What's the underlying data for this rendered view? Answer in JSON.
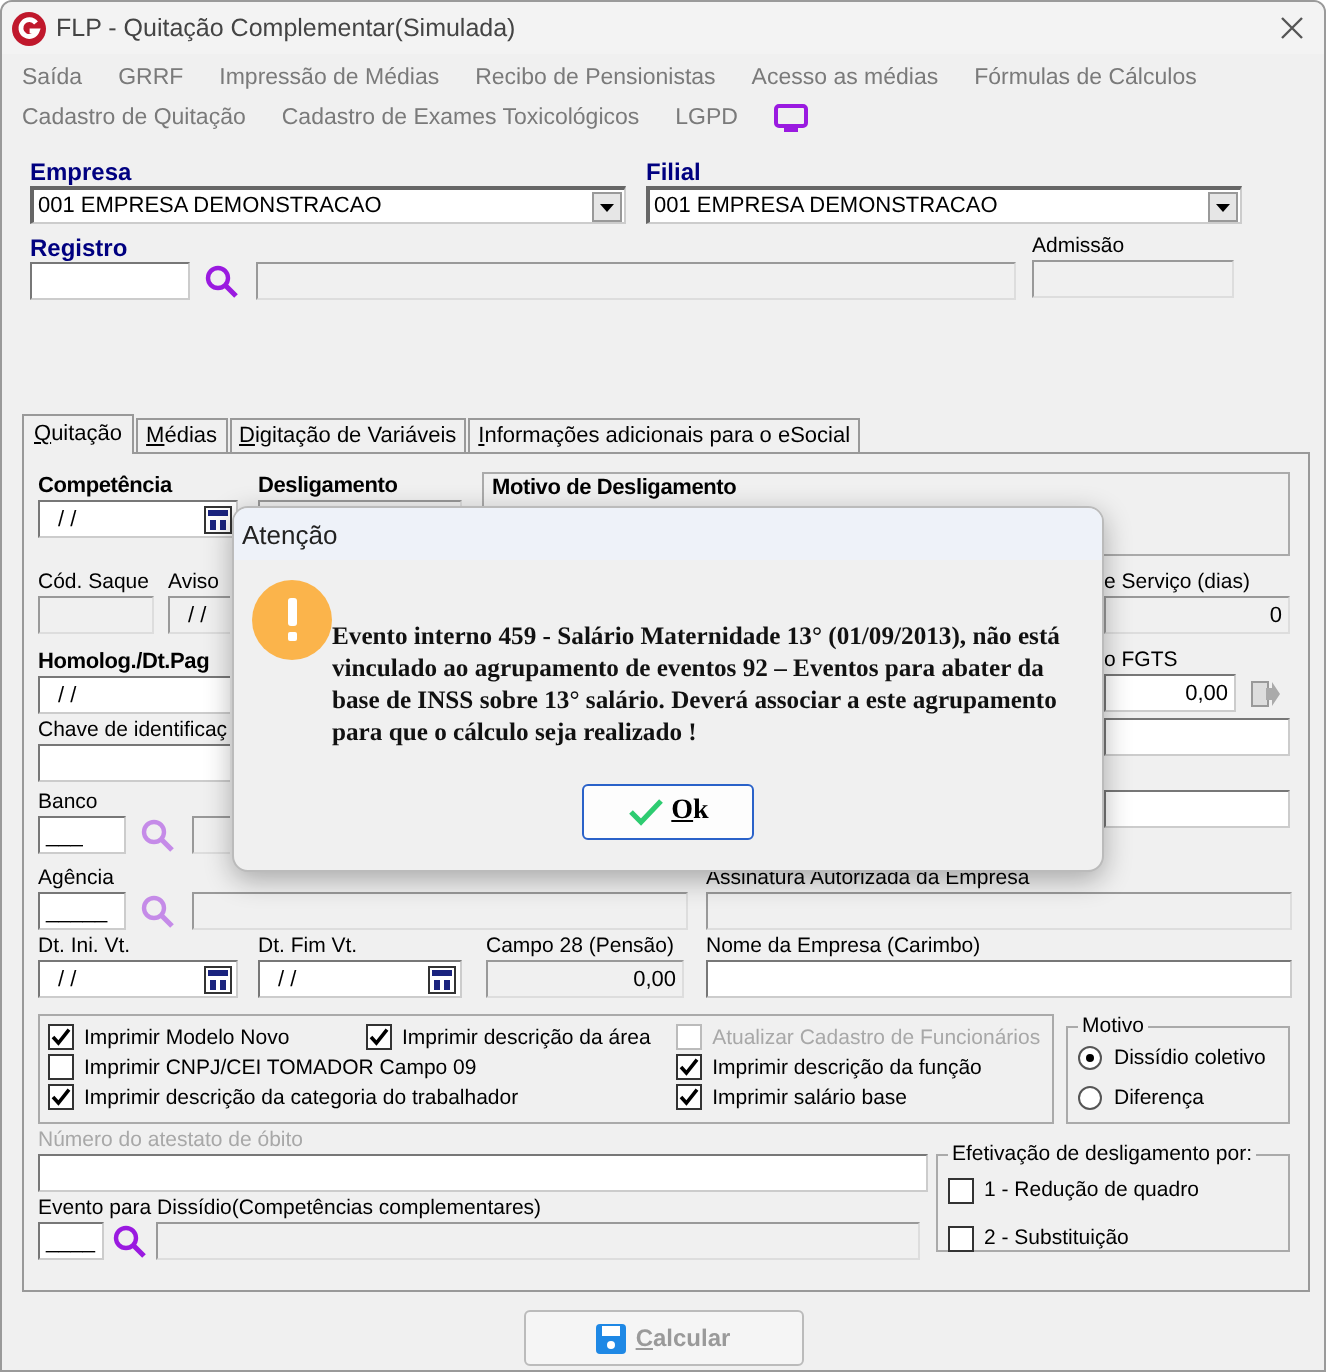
{
  "window": {
    "title": "FLP - Quitação Complementar(Simulada)"
  },
  "menu": [
    [
      {
        "label": "Saída"
      },
      {
        "label": "GRRF"
      },
      {
        "label": "Impressão de Médias"
      },
      {
        "label": "Recibo de Pensionistas"
      },
      {
        "label": "Acesso as médias"
      },
      {
        "label": "Fórmulas de Cálculos"
      }
    ],
    [
      {
        "label": "Cadastro de Quitação"
      },
      {
        "label": "Cadastro de Exames Toxicológicos"
      },
      {
        "label": "LGPD"
      }
    ]
  ],
  "header": {
    "empresa": {
      "label": "Empresa",
      "value": "001 EMPRESA DEMONSTRACAO"
    },
    "filial": {
      "label": "Filial",
      "value": "001 EMPRESA DEMONSTRACAO"
    },
    "registro": {
      "label": "Registro"
    },
    "admissao": {
      "label": "Admissão"
    }
  },
  "tabs": [
    {
      "label": "Quitação",
      "selected": true
    },
    {
      "label": "Médias",
      "selected": false
    },
    {
      "label": "Digitação de Variáveis",
      "selected": false
    },
    {
      "label": "Informações adicionais para o eSocial",
      "selected": false
    }
  ],
  "quitacao": {
    "competencia": {
      "label": "Competência",
      "value": "/ /"
    },
    "desligamento": {
      "label": "Desligamento"
    },
    "motivo_desligamento": {
      "label": "Motivo de Desligamento"
    },
    "cod_saque": {
      "label": "Cód. Saque"
    },
    "aviso": {
      "label": "Aviso",
      "value": "/ /"
    },
    "tempo_servico": {
      "label": "e Serviço (dias)",
      "value": "0"
    },
    "homolog": {
      "label": "Homolog./Dt.Pag",
      "value": "/ /"
    },
    "fgts": {
      "label": "o FGTS",
      "value": "0,00"
    },
    "chave": {
      "label": "Chave de identificaç"
    },
    "banco": {
      "label": "Banco",
      "value": "___"
    },
    "agencia": {
      "label": "Agência",
      "value": "_____"
    },
    "assinatura": {
      "label": "Assinatura Autorizada da Empresa"
    },
    "dt_ini_vt": {
      "label": "Dt. Ini. Vt.",
      "value": "/ /"
    },
    "dt_fim_vt": {
      "label": "Dt. Fim Vt.",
      "value": "/ /"
    },
    "campo28": {
      "label": "Campo 28 (Pensão)",
      "value": "0,00"
    },
    "nome_empresa": {
      "label": "Nome da Empresa (Carimbo)"
    },
    "checkbox_columns": [
      [
        {
          "label": "Imprimir Modelo Novo",
          "checked": true,
          "disabled": false
        },
        {
          "label": "Imprimir CNPJ/CEI TOMADOR Campo 09",
          "checked": false,
          "disabled": false
        },
        {
          "label": "Imprimir descrição da categoria do trabalhador",
          "checked": true,
          "disabled": false
        }
      ],
      [
        {
          "label": "Imprimir descrição da área",
          "checked": true,
          "disabled": false
        }
      ],
      [
        {
          "label": "Atualizar Cadastro de Funcionários",
          "checked": false,
          "disabled": true
        },
        {
          "label": "Imprimir descrição da função",
          "checked": true,
          "disabled": false
        },
        {
          "label": "Imprimir salário base",
          "checked": true,
          "disabled": false
        }
      ]
    ],
    "motivo": {
      "label": "Motivo",
      "options": [
        {
          "label": "Dissídio coletivo",
          "selected": true
        },
        {
          "label": "Diferença",
          "selected": false
        }
      ]
    },
    "atestado": {
      "label": "Número do atestato de óbito",
      "disabled": true
    },
    "efetivacao": {
      "label": "Efetivação de desligamento por:",
      "options": [
        {
          "label": "1 - Redução de quadro",
          "checked": false
        },
        {
          "label": "2 - Substituição",
          "checked": false
        }
      ]
    },
    "evento_dissidio": {
      "label": "Evento para Dissídio(Competências complementares)",
      "value": "____"
    }
  },
  "dialog": {
    "title": "Atenção",
    "message": "Evento interno 459 - Salário Maternidade 13° (01/09/2013), não está vinculado ao agrupamento de eventos 92 – Eventos para abater da base de INSS sobre 13° salário. Deverá associar a este agrupamento para que o cálculo seja realizado !",
    "button": "Ok"
  },
  "footer": {
    "button": {
      "label": "Calcular",
      "disabled": true
    }
  }
}
